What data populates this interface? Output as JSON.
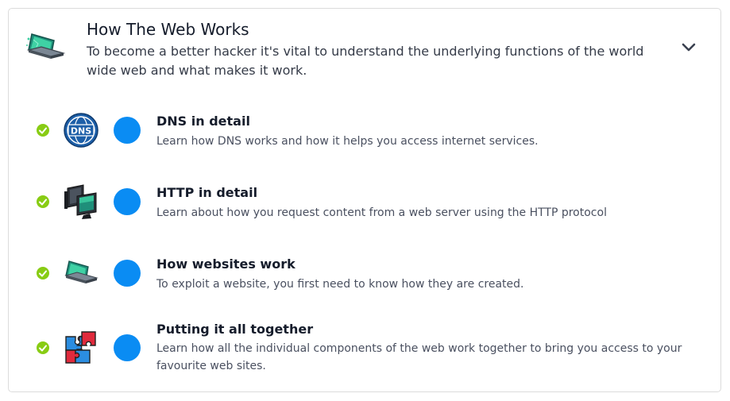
{
  "module": {
    "title": "How The Web Works",
    "description": "To become a better hacker it's vital to understand the underlying functions of the world wide web and what makes it work.",
    "icon": "laptop-icon",
    "expanded": true
  },
  "rooms": [
    {
      "title": "DNS in detail",
      "description": "Learn how DNS works and how it helps you access internet services.",
      "icon": "dns-globe-icon",
      "icon_text": "DNS",
      "completed": true
    },
    {
      "title": "HTTP in detail",
      "description": "Learn about how you request content from a web server using the HTTP protocol",
      "icon": "monitors-icon",
      "completed": true
    },
    {
      "title": "How websites work",
      "description": "To exploit a website, you first need to know how they are created.",
      "icon": "laptop-icon",
      "completed": true
    },
    {
      "title": "Putting it all together",
      "description": "Learn how all the individual components of the web work together to bring you access to your favourite web sites.",
      "icon": "puzzle-icon",
      "completed": true
    }
  ],
  "colors": {
    "check": "#88cc14",
    "dot": "#0a8cf3",
    "title": "#151c2b",
    "text": "#4a5060"
  }
}
